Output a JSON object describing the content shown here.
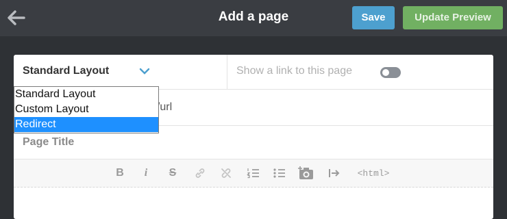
{
  "header": {
    "title": "Add a page",
    "save_label": "Save",
    "preview_label": "Update Preview"
  },
  "layout": {
    "selected": "Standard Layout",
    "options": [
      "Standard Layout",
      "Custom Layout",
      "Redirect"
    ],
    "highlighted_option": "Redirect"
  },
  "link_toggle": {
    "label": "Show a link to this page",
    "enabled": false
  },
  "url": {
    "visible_text": "n/url"
  },
  "page_title": {
    "placeholder": "Page Title"
  },
  "editor_toolbar": {
    "html_label": "<html>",
    "tools": [
      "bold-icon",
      "italic-icon",
      "strikethrough-icon",
      "link-icon",
      "unlink-icon",
      "ordered-list-icon",
      "bullet-list-icon",
      "insert-image-icon",
      "insert-button-icon",
      "html-source-icon"
    ]
  },
  "colors": {
    "save": "#4da0cf",
    "preview": "#71b062",
    "highlight": "#1e90ff",
    "topbar": "#3a3d42"
  }
}
